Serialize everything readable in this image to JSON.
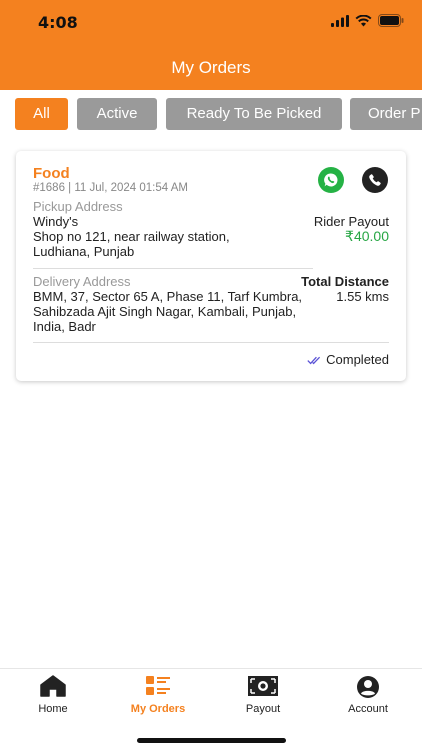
{
  "status_bar": {
    "time": "4:08"
  },
  "header": {
    "title": "My Orders"
  },
  "tabs": [
    {
      "label": "All",
      "active": true
    },
    {
      "label": "Active",
      "active": false
    },
    {
      "label": "Ready To Be Picked",
      "active": false
    },
    {
      "label": "Order P",
      "active": false
    }
  ],
  "order": {
    "category": "Food",
    "meta": "#1686 | 11 Jul, 2024 01:54 AM",
    "pickup_label": "Pickup Address",
    "pickup_name": "Windy's",
    "pickup_line1": "Shop no 121, near railway station,",
    "pickup_line2": "Ludhiana, Punjab",
    "payout_label": "Rider Payout",
    "payout_value": "₹40.00",
    "delivery_label": "Delivery Address",
    "delivery_line1": "BMM, 37, Sector 65 A, Phase 11, Tarf Kumbra,",
    "delivery_line2": "Sahibzada Ajit Singh Nagar, Kambali, Punjab,",
    "delivery_line3": "India, Badr",
    "distance_label": "Total Distance",
    "distance_value": "1.55 kms",
    "status": "Completed",
    "whatsapp_icon": "whatsapp-icon",
    "phone_icon": "phone-icon"
  },
  "bottom_nav": [
    {
      "label": "Home",
      "icon": "home-icon",
      "active": false
    },
    {
      "label": "My Orders",
      "icon": "orders-icon",
      "active": true
    },
    {
      "label": "Payout",
      "icon": "payout-icon",
      "active": false
    },
    {
      "label": "Account",
      "icon": "account-icon",
      "active": false
    }
  ],
  "colors": {
    "accent": "#f4811f",
    "inactive_tab": "#9a9a9a",
    "payout_green": "#27a644",
    "whatsapp_green": "#25b245"
  }
}
